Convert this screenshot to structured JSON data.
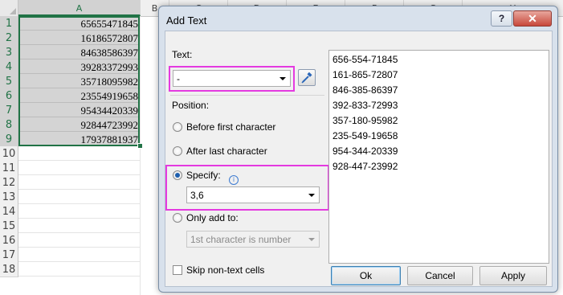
{
  "spreadsheet": {
    "columns": [
      "A",
      "B",
      "C",
      "D",
      "E",
      "F",
      "G",
      "H"
    ],
    "selected_column": "A",
    "row_numbers": [
      "1",
      "2",
      "3",
      "4",
      "5",
      "6",
      "7",
      "8",
      "9",
      "10",
      "11",
      "12",
      "13",
      "14",
      "15",
      "16",
      "17",
      "18"
    ],
    "column_a_values": [
      "65655471845",
      "16186572807",
      "84638586397",
      "39283372993",
      "35718095982",
      "23554919658",
      "95434420339",
      "92844723992",
      "17937881937"
    ],
    "accent_color": "#217346"
  },
  "dialog": {
    "title": "Add Text",
    "help_label": "?",
    "close_label": "✕",
    "text_label": "Text:",
    "text_value": "-",
    "position_label": "Position:",
    "options": {
      "before_first": "Before first character",
      "after_last": "After last character",
      "specify": "Specify:",
      "only_add_to": "Only add to:"
    },
    "selected_option": "specify",
    "specify_value": "3,6",
    "only_add_to_value": "1st character is number",
    "skip_non_text_label": "Skip non-text cells",
    "skip_non_text_checked": false,
    "preview_lines": [
      "656-554-71845",
      "161-865-72807",
      "846-385-86397",
      "392-833-72993",
      "357-180-95982",
      "235-549-19658",
      "954-344-20339",
      "928-447-23992"
    ],
    "buttons": {
      "ok": "Ok",
      "cancel": "Cancel",
      "apply": "Apply"
    },
    "highlight_color": "#e43ae0",
    "icons": [
      "help-icon",
      "close-icon",
      "eyedropper-icon",
      "info-icon",
      "dropdown-arrow-icon"
    ]
  }
}
